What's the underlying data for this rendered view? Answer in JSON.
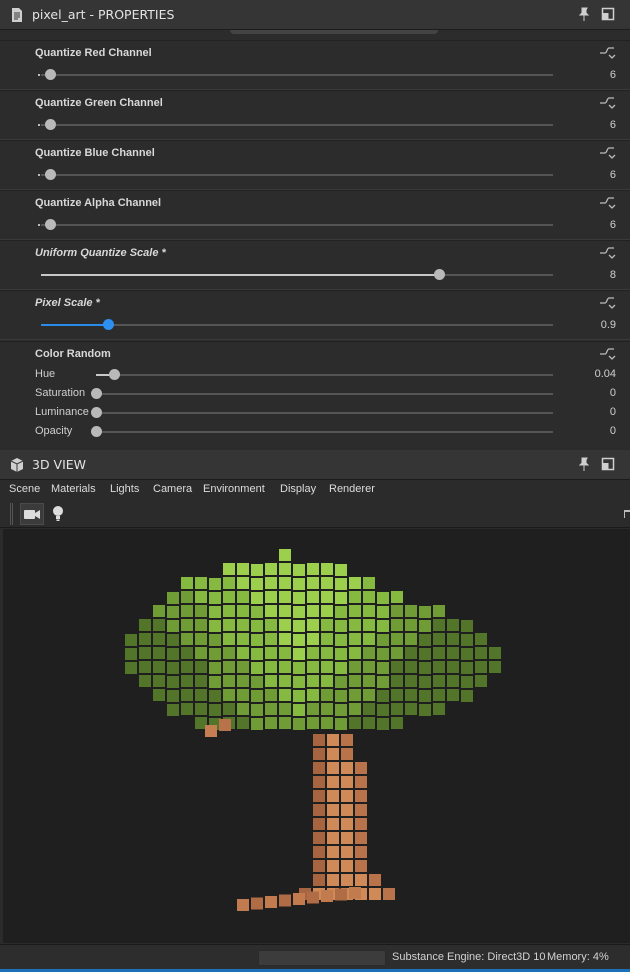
{
  "properties_panel": {
    "title": "pixel_art - PROPERTIES",
    "params": [
      {
        "label": "Quantize Red Channel",
        "value": "6",
        "fraction": 0.0,
        "italic": false,
        "accent": false
      },
      {
        "label": "Quantize Green Channel",
        "value": "6",
        "fraction": 0.0,
        "italic": false,
        "accent": false
      },
      {
        "label": "Quantize Blue Channel",
        "value": "6",
        "fraction": 0.0,
        "italic": false,
        "accent": false
      },
      {
        "label": "Quantize Alpha Channel",
        "value": "6",
        "fraction": 0.0,
        "italic": false,
        "accent": false
      },
      {
        "label": "Uniform Quantize Scale *",
        "value": "8",
        "fraction": 0.777,
        "italic": true,
        "accent": false
      },
      {
        "label": "Pixel Scale *",
        "value": "0.9",
        "fraction": 0.131,
        "italic": true,
        "accent": true
      }
    ],
    "color_random": {
      "label": "Color Random",
      "rows": [
        {
          "label": "Hue",
          "value": "0.04",
          "fraction": 0.04
        },
        {
          "label": "Saturation",
          "value": "0",
          "fraction": 0.0
        },
        {
          "label": "Luminance",
          "value": "0",
          "fraction": 0.0
        },
        {
          "label": "Opacity",
          "value": "0",
          "fraction": 0.0
        }
      ]
    }
  },
  "view_panel": {
    "title": "3D VIEW",
    "menu": [
      "Scene",
      "Materials",
      "Lights",
      "Camera",
      "Environment",
      "Display",
      "Renderer"
    ]
  },
  "status_bar": {
    "engine": "Substance Engine: Direct3D 10",
    "memory": "Memory: 4%"
  },
  "icons": [
    "document-icon",
    "pin-icon",
    "maximize-icon",
    "cube-icon",
    "camera-icon",
    "lightbulb-icon",
    "reset-icon"
  ],
  "colors": {
    "accent": "#2e8ff0",
    "foliage": "#8fc23f",
    "trunk": "#c47e52",
    "background": "#1f1f1f"
  }
}
